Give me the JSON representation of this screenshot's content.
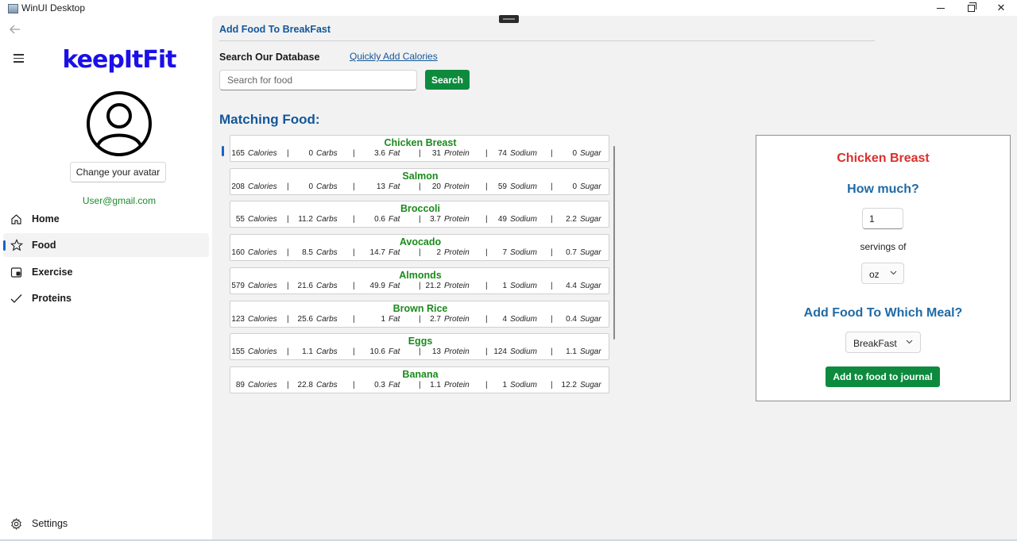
{
  "window": {
    "title": "WinUI Desktop"
  },
  "sidebar": {
    "logo": "keepItFit",
    "avatar_button": "Change your avatar",
    "email": "User@gmail.com",
    "items": [
      {
        "label": "Home",
        "icon": "home-icon"
      },
      {
        "label": "Food",
        "icon": "star-icon",
        "active": true
      },
      {
        "label": "Exercise",
        "icon": "exercise-icon"
      },
      {
        "label": "Proteins",
        "icon": "check-icon"
      }
    ],
    "settings": {
      "label": "Settings",
      "icon": "gear-icon"
    }
  },
  "main": {
    "page_title": "Add Food To BreakFast",
    "search_label": "Search Our Database",
    "quick_link": "Quickly Add Calories",
    "search_placeholder": "Search for food",
    "search_button": "Search",
    "matching_heading": "Matching Food:",
    "units": [
      "Calories",
      "Carbs",
      "Fat",
      "Protein",
      "Sodium",
      "Sugar"
    ],
    "separator": "|",
    "foods": [
      {
        "name": "Chicken Breast",
        "values": [
          "165",
          "0",
          "3.6",
          "31",
          "74",
          "0"
        ]
      },
      {
        "name": "Salmon",
        "values": [
          "208",
          "0",
          "13",
          "20",
          "59",
          "0"
        ]
      },
      {
        "name": "Broccoli",
        "values": [
          "55",
          "11.2",
          "0.6",
          "3.7",
          "49",
          "2.2"
        ]
      },
      {
        "name": "Avocado",
        "values": [
          "160",
          "8.5",
          "14.7",
          "2",
          "7",
          "0.7"
        ]
      },
      {
        "name": "Almonds",
        "values": [
          "579",
          "21.6",
          "49.9",
          "21.2",
          "1",
          "4.4"
        ]
      },
      {
        "name": "Brown Rice",
        "values": [
          "123",
          "25.6",
          "1",
          "2.7",
          "4",
          "0.4"
        ]
      },
      {
        "name": "Eggs",
        "values": [
          "155",
          "1.1",
          "10.6",
          "13",
          "124",
          "1.1"
        ]
      },
      {
        "name": "Banana",
        "values": [
          "89",
          "22.8",
          "0.3",
          "1.1",
          "1",
          "12.2"
        ]
      }
    ]
  },
  "detail": {
    "food_name": "Chicken Breast",
    "how_much": "How much?",
    "quantity": "1",
    "servings_of": "servings of",
    "unit": "oz",
    "meal_question": "Add Food To Which Meal?",
    "meal": "BreakFast",
    "add_button": "Add to food to journal"
  },
  "colors": {
    "accent_green": "#0e8a3f",
    "food_name_green": "#1b8a1b",
    "heading_blue": "#13579a",
    "detail_red": "#d9302c",
    "logo_blue": "#1a10e8"
  }
}
